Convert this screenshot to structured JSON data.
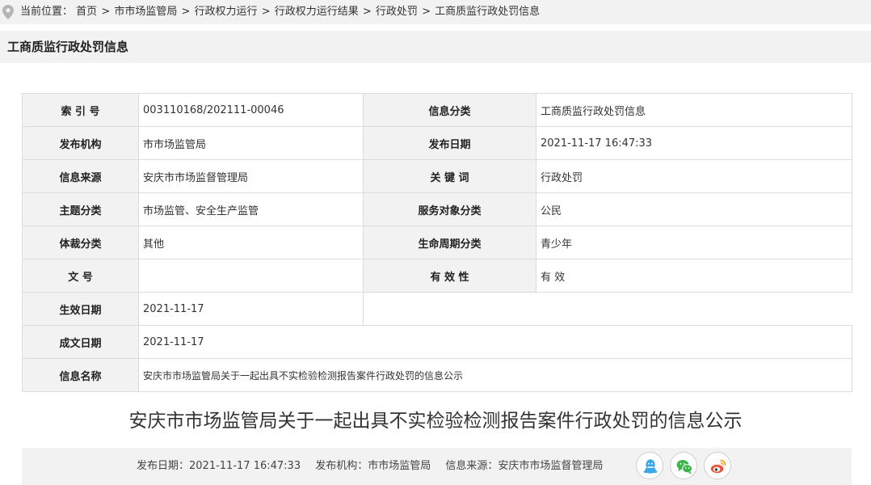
{
  "breadcrumb": {
    "label": "当前位置：",
    "items": [
      "首页",
      "市市场监管局",
      "行政权力运行",
      "行政权力运行结果",
      "行政处罚",
      "工商质监行政处罚信息"
    ]
  },
  "section_title": "工商质监行政处罚信息",
  "meta": {
    "index_no": {
      "label": "索 引 号",
      "value": "003110168/202111-00046"
    },
    "category": {
      "label": "信息分类",
      "value": "工商质监行政处罚信息"
    },
    "publisher": {
      "label": "发布机构",
      "value": "市市场监管局"
    },
    "publish_date": {
      "label": "发布日期",
      "value": "2021-11-17 16:47:33"
    },
    "source": {
      "label": "信息来源",
      "value": "安庆市市场监督管理局"
    },
    "keywords": {
      "label": "关 键 词",
      "value": "行政处罚"
    },
    "topic": {
      "label": "主题分类",
      "value": "市场监管、安全生产监管"
    },
    "audience": {
      "label": "服务对象分类",
      "value": "公民"
    },
    "genre": {
      "label": "体裁分类",
      "value": "其他"
    },
    "lifecycle": {
      "label": "生命周期分类",
      "value": "青少年"
    },
    "doc_no": {
      "label": "文 号",
      "value": ""
    },
    "validity": {
      "label": "有 效 性",
      "value": "有 效"
    },
    "effective_date": {
      "label": "生效日期",
      "value": "2021-11-17"
    },
    "written_date": {
      "label": "成文日期",
      "value": "2021-11-17"
    },
    "info_name": {
      "label": "信息名称",
      "value": "安庆市市场监管局关于一起出具不实检验检测报告案件行政处罚的信息公示"
    }
  },
  "doc_title": "安庆市市场监管局关于一起出具不实检验检测报告案件行政处罚的信息公示",
  "footer": {
    "date_label": "发布日期：",
    "date_value": "2021-11-17 16:47:33",
    "org_label": "发布机构：",
    "org_value": "市市场监管局",
    "source_label": "信息来源：",
    "source_value": "安庆市市场监督管理局"
  },
  "share": [
    {
      "icon": "qq-icon",
      "color": "#3aa8e8"
    },
    {
      "icon": "wechat-icon",
      "color": "#3bb44a"
    },
    {
      "icon": "weibo-icon",
      "color": "#e9573f"
    }
  ]
}
